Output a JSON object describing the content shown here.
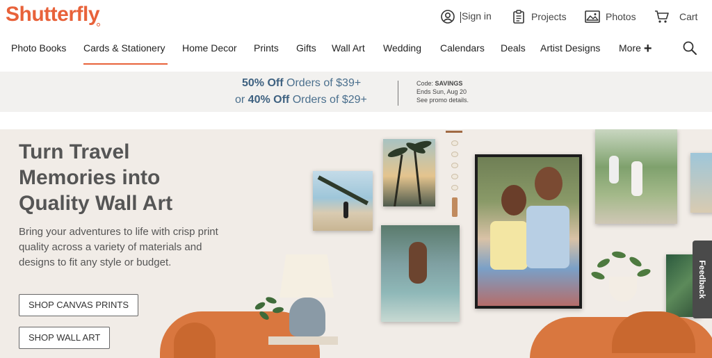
{
  "brand": {
    "logo": "Shutterfly",
    "accent": "#e8623a"
  },
  "utility": {
    "sign_in": "Sign in",
    "projects": "Projects",
    "photos": "Photos",
    "cart": "Cart"
  },
  "nav": {
    "items": [
      {
        "label": "Photo Books"
      },
      {
        "label": "Cards & Stationery",
        "active": true
      },
      {
        "label": "Home Decor"
      },
      {
        "label": "Prints"
      },
      {
        "label": "Gifts"
      },
      {
        "label": "Wall Art"
      },
      {
        "label": "Wedding"
      },
      {
        "label": "Calendars"
      },
      {
        "label": "Deals"
      },
      {
        "label": "Artist Designs"
      },
      {
        "label": "More"
      }
    ]
  },
  "promo": {
    "line1_bold": "50% Off",
    "line1_rest": " Orders of $39+",
    "line2_prefix": "or ",
    "line2_bold": "40% Off",
    "line2_rest": " Orders of $29+",
    "code_label": "Code: ",
    "code": "SAVINGS",
    "ends": "Ends Sun, Aug 20",
    "details": "See promo details."
  },
  "hero": {
    "title_line1": "Turn Travel",
    "title_line2": "Memories into",
    "title_line3": "Quality Wall Art",
    "subtitle": "Bring your adventures to life with crisp print quality across a variety of materials and designs to fit any style or budget.",
    "cta_primary": "SHOP CANVAS PRINTS",
    "cta_secondary": "SHOP WALL ART"
  },
  "feedback": "Feedback"
}
